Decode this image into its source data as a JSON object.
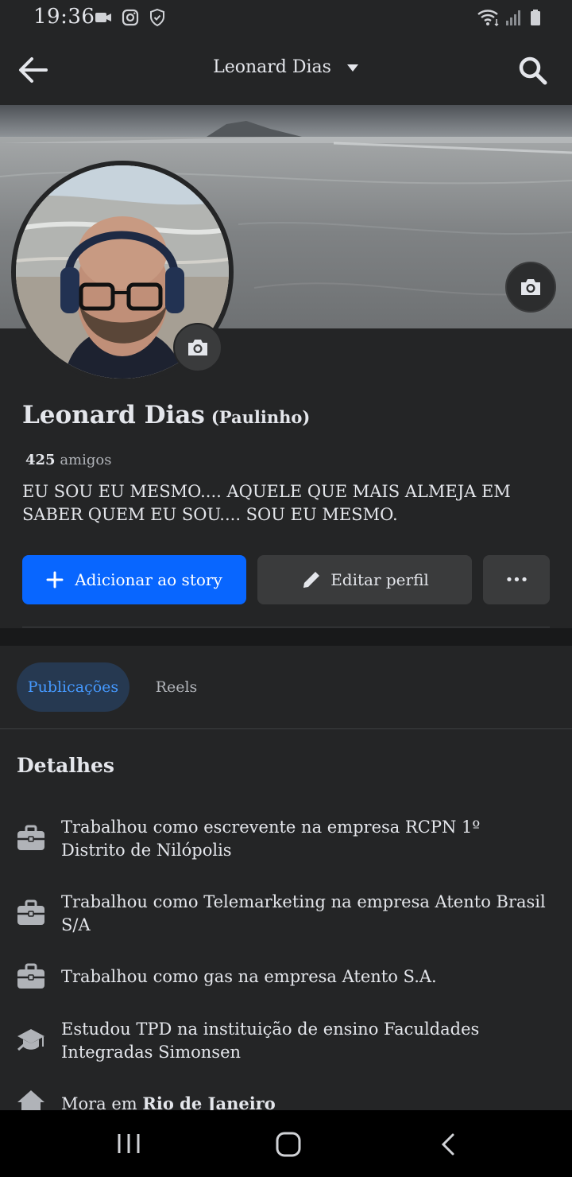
{
  "status_bar": {
    "time": "19:36"
  },
  "header": {
    "title": "Leonard Dias"
  },
  "profile": {
    "name": "Leonard Dias",
    "nickname": "(Paulinho)",
    "friends_count": "425",
    "friends_label": "amigos",
    "bio": "EU SOU EU MESMO.... AQUELE QUE MAIS ALMEJA EM SABER QUEM EU SOU.... SOU EU MESMO."
  },
  "actions": {
    "add_story": "Adicionar ao story",
    "edit_profile": "Editar perfil",
    "more": "•••"
  },
  "tabs": [
    {
      "label": "Publicações",
      "active": true
    },
    {
      "label": "Reels",
      "active": false
    }
  ],
  "details": {
    "title": "Detalhes",
    "items": [
      {
        "icon": "briefcase-icon",
        "text": "Trabalhou como escrevente na empresa RCPN 1º Distrito de Nilópolis"
      },
      {
        "icon": "briefcase-icon",
        "text": "Trabalhou como Telemarketing na empresa Atento Brasil S/A"
      },
      {
        "icon": "briefcase-icon",
        "text": "Trabalhou como gas na empresa Atento S.A."
      },
      {
        "icon": "graduation-cap-icon",
        "text": "Estudou TPD na instituição de ensino Faculdades Integradas Simonsen"
      },
      {
        "icon": "home-icon",
        "prefix": "Mora em",
        "place": "Rio de Janeiro"
      }
    ]
  },
  "colors": {
    "background": "#242526",
    "primary": "#0866ff",
    "secondary_button": "#3a3b3c",
    "active_tab_bg": "#263951",
    "active_tab_text": "#4599ff"
  }
}
